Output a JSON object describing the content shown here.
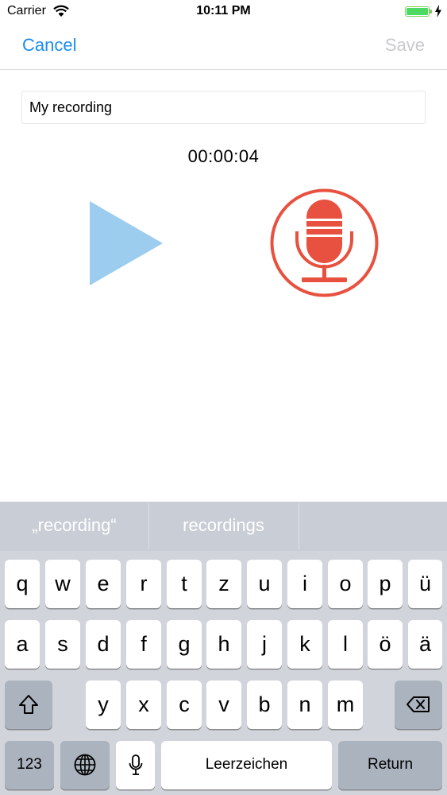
{
  "status_bar": {
    "carrier": "Carrier",
    "time": "10:11 PM",
    "battery_color": "#4cd964"
  },
  "nav": {
    "cancel_label": "Cancel",
    "save_label": "Save",
    "accent_color": "#1a8cf0"
  },
  "recording": {
    "title_value": "My recording",
    "timer": "00:00:04",
    "play_color": "#9ccdee",
    "record_color": "#e8513f"
  },
  "keyboard": {
    "suggestions": [
      "„recording“",
      "recordings",
      ""
    ],
    "row1": [
      "q",
      "w",
      "e",
      "r",
      "t",
      "z",
      "u",
      "i",
      "o",
      "p",
      "ü"
    ],
    "row2": [
      "a",
      "s",
      "d",
      "f",
      "g",
      "h",
      "j",
      "k",
      "l",
      "ö",
      "ä"
    ],
    "row3": [
      "y",
      "x",
      "c",
      "v",
      "b",
      "n",
      "m"
    ],
    "numbers_label": "123",
    "space_label": "Leerzeichen",
    "return_label": "Return",
    "icons": [
      "shift-icon",
      "backspace-icon",
      "globe-icon",
      "dictation-mic-icon"
    ]
  }
}
